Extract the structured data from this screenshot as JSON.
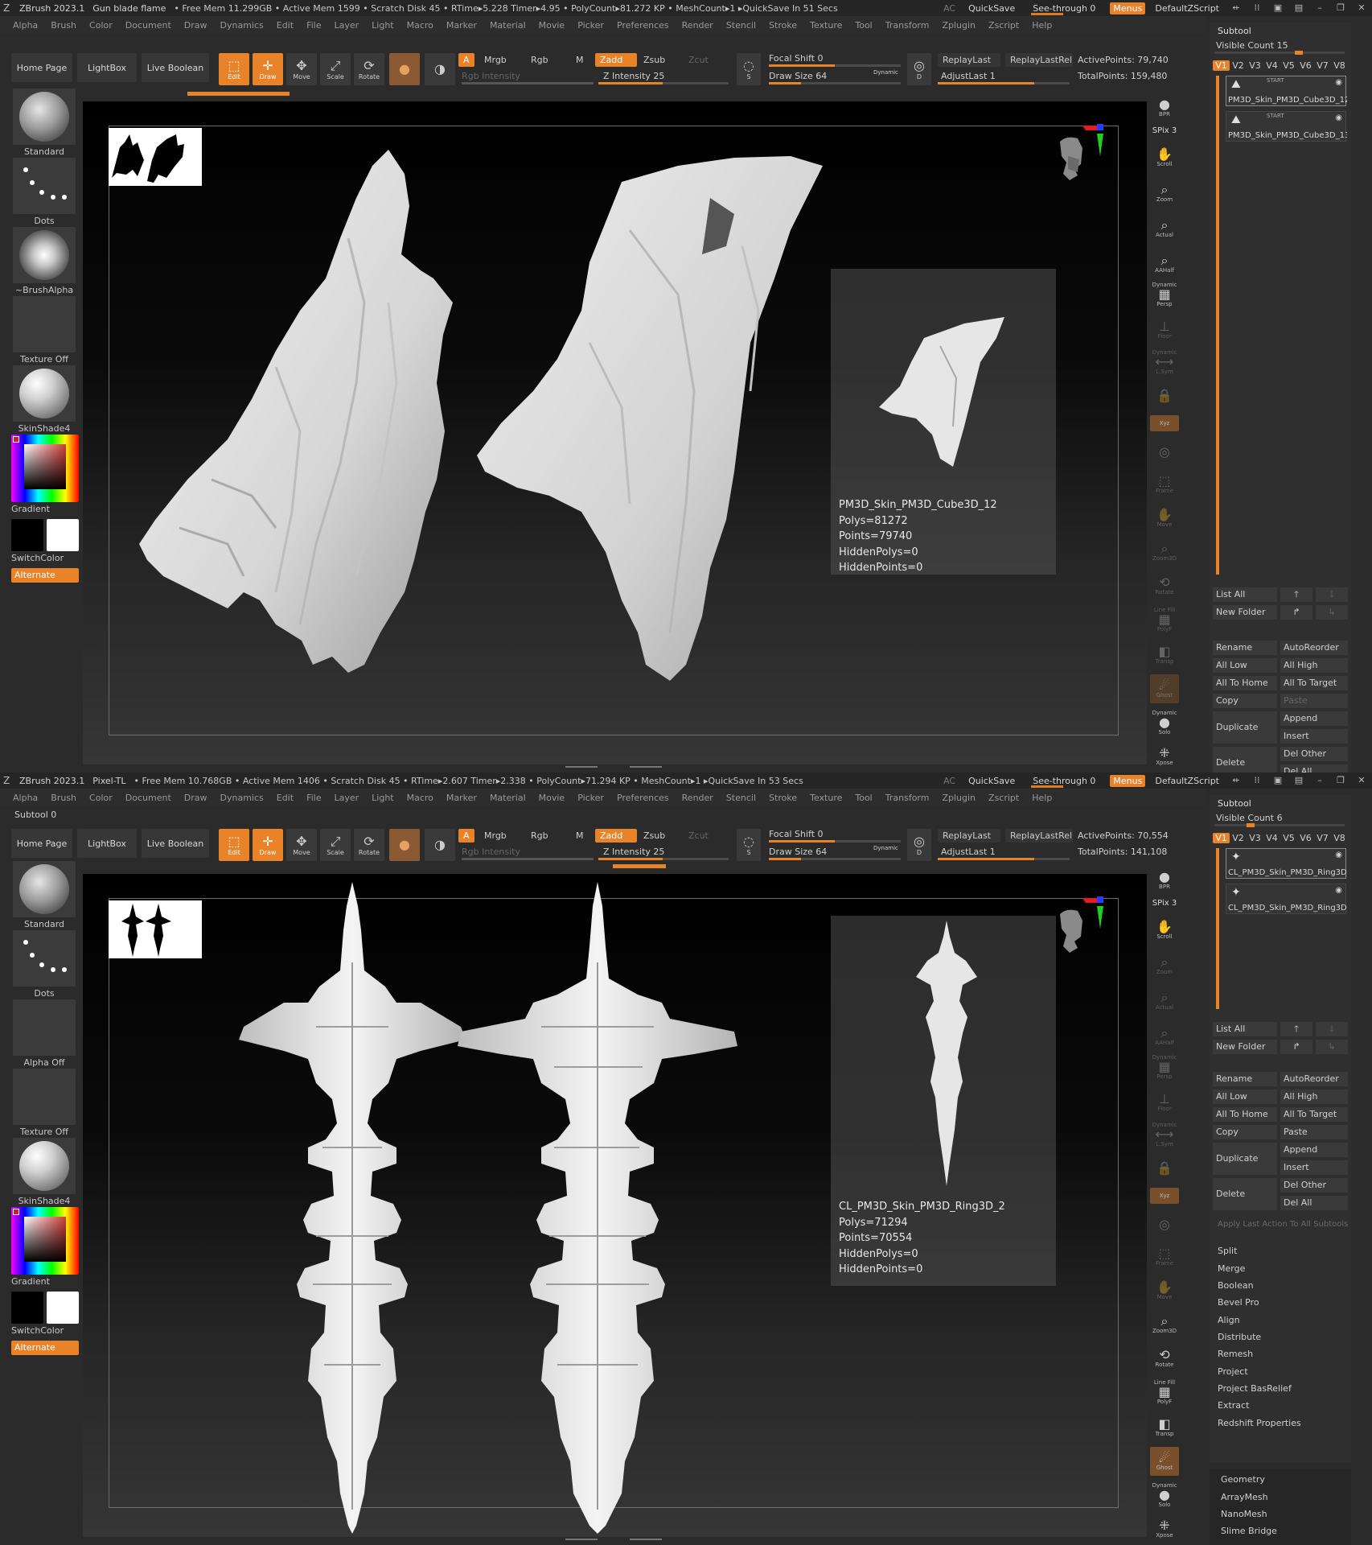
{
  "windows": [
    {
      "title": {
        "app": "ZBrush 2023.1",
        "doc": "Gun blade flame",
        "stats": "• Free Mem 11.299GB • Active Mem 1599 • Scratch Disk 45 • RTime▸5.228 Timer▸4.95 • PolyCount▸81.272 KP • MeshCount▸1 ▸QuickSave In 51 Secs"
      },
      "subtool_zero": "",
      "shelf": {
        "intensity": "Z Intensity 25",
        "active_points": "ActivePoints: 79,740",
        "total_points": "TotalPoints: 159,480"
      },
      "brush": {
        "brush": "Standard",
        "stroke": "Dots",
        "alpha": "~BrushAlpha",
        "texture": "Texture Off",
        "material": "SkinShade4"
      },
      "info": {
        "name": "PM3D_Skin_PM3D_Cube3D_12",
        "polys": "Polys=81272",
        "points": "Points=79740",
        "hidden_polys": "HiddenPolys=0",
        "hidden_points": "HiddenPoints=0"
      },
      "subtool": {
        "title": "Subtool",
        "visible_count": "Visible Count 15",
        "items": [
          "PM3D_Skin_PM3D_Cube3D_12",
          "PM3D_Skin_PM3D_Cube3D_13"
        ]
      }
    },
    {
      "title": {
        "app": "ZBrush 2023.1",
        "doc": "Pixel-TL",
        "stats": "• Free Mem 10.768GB • Active Mem 1406 • Scratch Disk 45 • RTime▸2.607 Timer▸2.338 • PolyCount▸71.294 KP • MeshCount▸1 ▸QuickSave In 53 Secs"
      },
      "subtool_zero": "Subtool 0",
      "shelf": {
        "intensity": "Z Intensity 25",
        "active_points": "ActivePoints: 70,554",
        "total_points": "TotalPoints: 141,108"
      },
      "brush": {
        "brush": "Standard",
        "stroke": "Dots",
        "alpha": "Alpha Off",
        "texture": "Texture Off",
        "material": "SkinShade4"
      },
      "info": {
        "name": "CL_PM3D_Skin_PM3D_Ring3D_2",
        "polys": "Polys=71294",
        "points": "Points=70554",
        "hidden_polys": "HiddenPolys=0",
        "hidden_points": "HiddenPoints=0"
      },
      "subtool": {
        "title": "Subtool",
        "visible_count": "Visible Count 6",
        "items": [
          "CL_PM3D_Skin_PM3D_Ring3D_2",
          "CL_PM3D_Skin_PM3D_Ring3D_"
        ]
      }
    }
  ],
  "titlebar_right": {
    "ac": "AC",
    "quicksave": "QuickSave",
    "seethrough": "See-through 0",
    "menus": "Menus",
    "script": "DefaultZScript"
  },
  "menus": [
    "Alpha",
    "Brush",
    "Color",
    "Document",
    "Draw",
    "Dynamics",
    "Edit",
    "File",
    "Layer",
    "Light",
    "Macro",
    "Marker",
    "Material",
    "Movie",
    "Picker",
    "Preferences",
    "Render",
    "Stencil",
    "Stroke",
    "Texture",
    "Tool",
    "Transform",
    "Zplugin",
    "Zscript",
    "Help"
  ],
  "shelf_common": {
    "home": "Home Page",
    "lightbox": "LightBox",
    "live_boolean": "Live Boolean",
    "edit": "Edit",
    "draw": "Draw",
    "move": "Move",
    "scale": "Scale",
    "rotate": "Rotate",
    "a": "A",
    "mrgb": "Mrgb",
    "rgb": "Rgb",
    "m": "M",
    "rgb_intensity": "Rgb Intensity",
    "zadd": "Zadd",
    "zsub": "Zsub",
    "zcut": "Zcut",
    "focal": "Focal Shift 0",
    "drawsize": "Draw Size 64",
    "dynamic": "Dynamic",
    "s": "S",
    "d": "D",
    "replaylast": "ReplayLast",
    "replaylastrel": "ReplayLastRel",
    "adjustlast": "AdjustLast 1"
  },
  "left_common": {
    "gradient": "Gradient",
    "switchcolor": "SwitchColor",
    "alternate": "Alternate"
  },
  "vstrip": [
    "BPR",
    "SPix 3",
    "Scroll",
    "Zoom",
    "Actual",
    "AAHalf",
    "Persp",
    "Floor",
    "L.Sym",
    "Xyz",
    "Frame",
    "Move",
    "Zoom3D",
    "Rotate",
    "PolyF",
    "Transp",
    "Ghost",
    "Solo",
    "Xpose"
  ],
  "vstrip_extra": {
    "dynamic": "Dynamic",
    "line_fill": "Line Fill"
  },
  "subtool_buttons": {
    "list_all": "List All",
    "new_folder": "New Folder",
    "rename": "Rename",
    "autoreorder": "AutoReorder",
    "all_low": "All Low",
    "all_high": "All High",
    "all_to_home": "All To Home",
    "all_to_target": "All To Target",
    "copy": "Copy",
    "paste": "Paste",
    "duplicate": "Duplicate",
    "append": "Append",
    "insert": "Insert",
    "delete": "Delete",
    "del_other": "Del Other",
    "del_all": "Del All",
    "apply_last": "Apply Last Action To All Subtools",
    "split": "Split",
    "merge": "Merge",
    "boolean": "Boolean",
    "bevel_pro": "Bevel Pro",
    "align": "Align",
    "distribute": "Distribute",
    "remesh": "Remesh",
    "project": "Project",
    "project_basrelief": "Project BasRelief",
    "extract": "Extract",
    "redshift": "Redshift Properties",
    "geometry": "Geometry",
    "arraymesh": "ArrayMesh",
    "nanomesh": "NanoMesh",
    "slime_bridge": "Slime Bridge"
  },
  "subtool_start_label": "START",
  "subtool_item_index": "1",
  "vtabs": [
    "V1",
    "V2",
    "V3",
    "V4",
    "V5",
    "V6",
    "V7",
    "V8"
  ],
  "colors": {
    "accent": "#e8832a",
    "panel": "#2f2f2f",
    "bg": "#2b2b2b"
  }
}
